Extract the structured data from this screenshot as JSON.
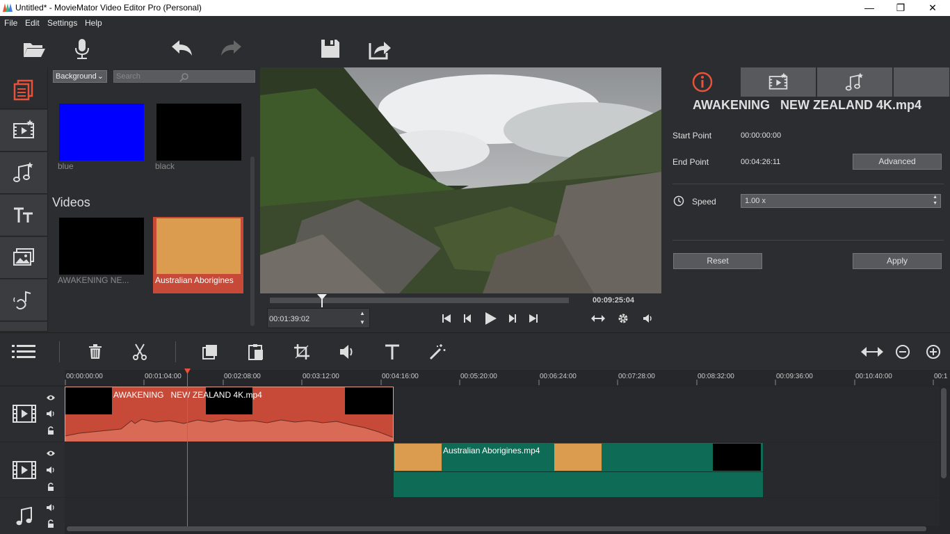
{
  "window": {
    "title": "Untitled* - MovieMator Video Editor Pro (Personal)",
    "minimize": "—",
    "maximize": "❐",
    "close": "✕"
  },
  "menu": [
    "File",
    "Edit",
    "Settings",
    "Help"
  ],
  "toolbar": {
    "icons": [
      "open-folder-icon",
      "microphone-icon",
      "undo-icon",
      "redo-icon",
      "save-icon",
      "export-icon"
    ]
  },
  "library": {
    "category": "Background",
    "search_placeholder": "Search",
    "colors": [
      {
        "name": "blue",
        "color": "#0000ff"
      },
      {
        "name": "black",
        "color": "#000000"
      }
    ],
    "videos_heading": "Videos",
    "videos": [
      {
        "name": "AWAKENING   NE..."
      },
      {
        "name": "Australian Aborigines"
      }
    ]
  },
  "player": {
    "current_time": "00:01:39:02",
    "total_time": "00:09:25:04",
    "progress": 0.173
  },
  "properties": {
    "filename": "AWAKENING   NEW ZEALAND 4K.mp4",
    "start_label": "Start Point",
    "start_value": "00:00:00:00",
    "end_label": "End Point",
    "end_value": "00:04:26:11",
    "advanced": "Advanced",
    "speed_label": "Speed",
    "speed_value": "1.00 x",
    "reset": "Reset",
    "apply": "Apply"
  },
  "timeline": {
    "ruler": [
      "00:00:00:00",
      "00:01:04:00",
      "00:02:08:00",
      "00:03:12:00",
      "00:04:16:00",
      "00:05:20:00",
      "00:06:24:00",
      "00:07:28:00",
      "00:08:32:00",
      "00:09:36:00",
      "00:10:40:00",
      "00:1"
    ],
    "clip1": "AWAKENING   NEW ZEALAND 4K.mp4",
    "clip2": "Australian Aborigines.mp4"
  },
  "colors": {
    "accent": "#e8523a",
    "clip_red": "#c64a37",
    "clip_green": "#0e6b56",
    "clip_orange": "#dc9c4f"
  }
}
